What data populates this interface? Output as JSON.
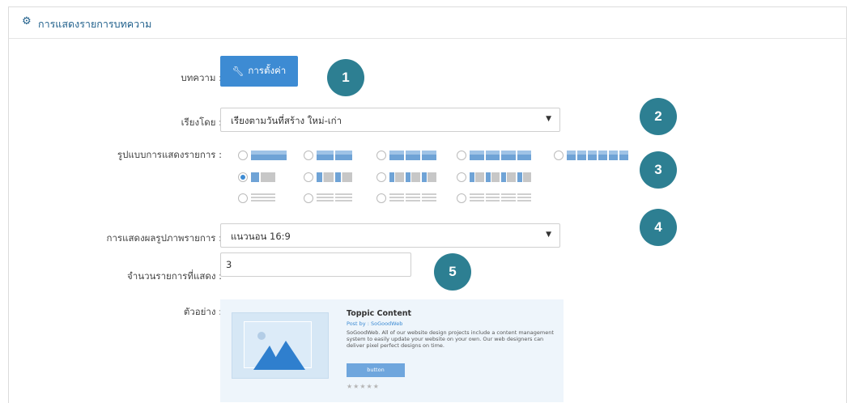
{
  "header": {
    "title": "การแสดงรายการบทความ",
    "icon": "gear-icon"
  },
  "article": {
    "label": "บทความ :",
    "button_label": "การตั้งค่า",
    "button_icon": "wrench-icon"
  },
  "sort": {
    "label": "เรียงโดย :",
    "value": "เรียงตามวันที่สร้าง ใหม่-เก่า"
  },
  "layout": {
    "label": "รูปแบบการแสดงรายการ :",
    "selected": "image-left-1col"
  },
  "image_display": {
    "label": "การแสดงผลรูปภาพรายการ :",
    "value": "แนวนอน 16:9"
  },
  "count": {
    "label": "จำนวนรายการที่แสดง :",
    "value": "3"
  },
  "example": {
    "label": "ตัวอย่าง :",
    "title": "Toppic Content",
    "posted_by": "Post by : SoGoodWeb",
    "description": "SoGoodWeb. All of our website design projects include a content management system to easily update your website on your own. Our web designers can deliver pixel perfect designs on time.",
    "button": "button",
    "stars": "★★★★★"
  },
  "steps": [
    "1",
    "2",
    "3",
    "4",
    "5"
  ],
  "colors": {
    "accent": "#3d8bd3",
    "badge": "#2d7f92",
    "header_text": "#1f5f8b"
  }
}
